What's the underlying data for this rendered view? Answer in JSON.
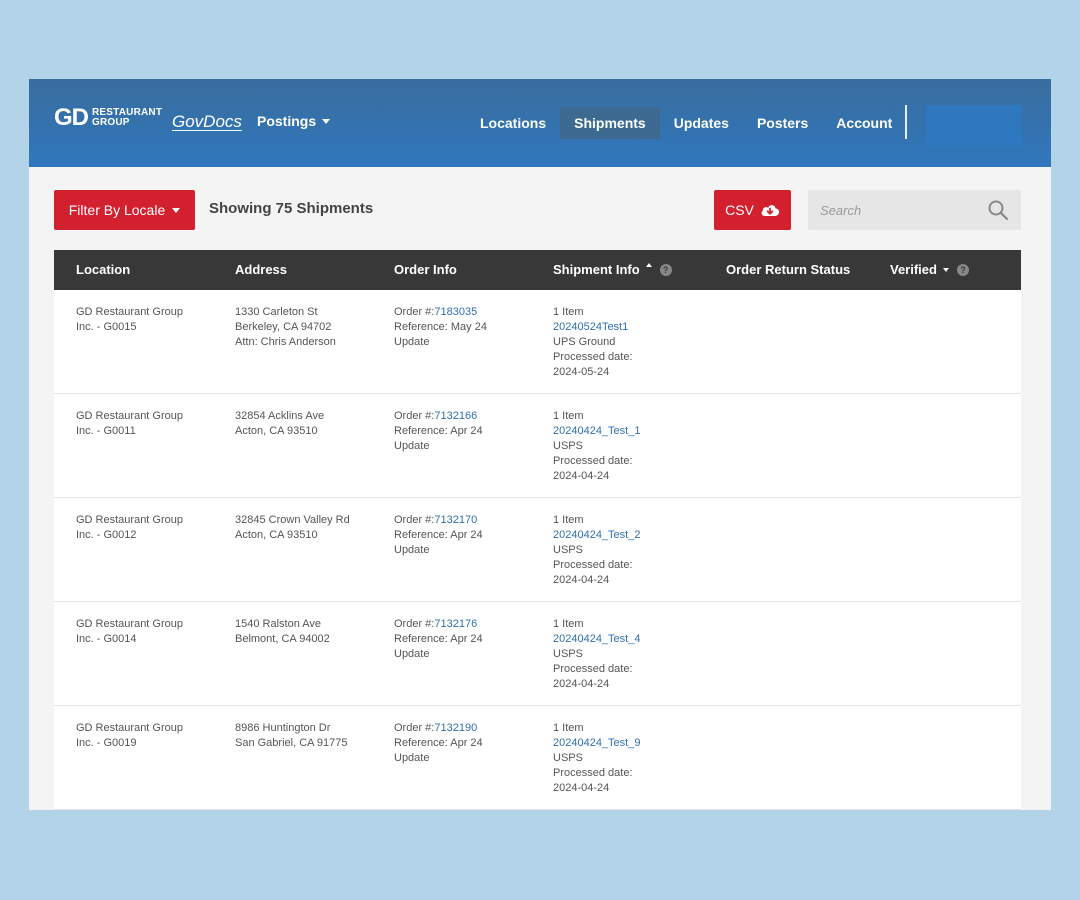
{
  "colors": {
    "page_bg": "#b3d3e8",
    "header_bg": "#2f77bd",
    "accent_red": "#d3202f",
    "table_header_bg": "#383838",
    "link": "#2f6fae"
  },
  "header": {
    "logo": {
      "mark": "GD",
      "line1": "RESTAURANT",
      "line2": "GROUP"
    },
    "brand": "GovDocs",
    "postings_label": "Postings",
    "nav": [
      {
        "label": "Locations",
        "active": false
      },
      {
        "label": "Shipments",
        "active": true
      },
      {
        "label": "Updates",
        "active": false
      },
      {
        "label": "Posters",
        "active": false
      },
      {
        "label": "Account",
        "active": false
      }
    ]
  },
  "toolbar": {
    "filter_label": "Filter By Locale",
    "showing_text": "Showing 75 Shipments",
    "csv_label": "CSV",
    "search_placeholder": "Search",
    "icons": {
      "csv": "cloud-download-icon",
      "search": "search-icon"
    }
  },
  "table": {
    "columns": [
      {
        "label": "Location"
      },
      {
        "label": "Address"
      },
      {
        "label": "Order Info"
      },
      {
        "label": "Shipment Info",
        "sort": "up",
        "help": true
      },
      {
        "label": "Order Return Status"
      },
      {
        "label": "Verified",
        "sort": "down",
        "help": true
      }
    ],
    "rows": [
      {
        "location": [
          "GD Restaurant Group",
          "Inc. - G0015"
        ],
        "address": [
          "1330 Carleton St",
          "Berkeley, CA 94702",
          "Attn: Chris Anderson"
        ],
        "order_prefix": "Order #:",
        "order_number": "7183035",
        "order_reference": [
          "Reference: May 24",
          "Update"
        ],
        "items": "1 Item",
        "shipment_id": "20240524Test1",
        "carrier": "UPS Ground",
        "processed_label": "Processed date:",
        "processed_date": "2024-05-24"
      },
      {
        "location": [
          "GD Restaurant Group",
          "Inc. - G0011"
        ],
        "address": [
          "32854 Acklins Ave",
          "Acton, CA 93510"
        ],
        "order_prefix": "Order #:",
        "order_number": "7132166",
        "order_reference": [
          "Reference: Apr 24",
          "Update"
        ],
        "items": "1 Item",
        "shipment_id": "20240424_Test_1",
        "carrier": "USPS",
        "processed_label": "Processed date:",
        "processed_date": "2024-04-24"
      },
      {
        "location": [
          "GD Restaurant Group",
          "Inc. - G0012"
        ],
        "address": [
          "32845 Crown Valley Rd",
          "Acton, CA 93510"
        ],
        "order_prefix": "Order #:",
        "order_number": "7132170",
        "order_reference": [
          "Reference: Apr 24",
          "Update"
        ],
        "items": "1 Item",
        "shipment_id": "20240424_Test_2",
        "carrier": "USPS",
        "processed_label": "Processed date:",
        "processed_date": "2024-04-24"
      },
      {
        "location": [
          "GD Restaurant Group",
          "Inc. - G0014"
        ],
        "address": [
          "1540 Ralston Ave",
          "Belmont, CA 94002"
        ],
        "order_prefix": "Order #:",
        "order_number": "7132176",
        "order_reference": [
          "Reference: Apr 24",
          "Update"
        ],
        "items": "1 Item",
        "shipment_id": "20240424_Test_4",
        "carrier": "USPS",
        "processed_label": "Processed date:",
        "processed_date": "2024-04-24"
      },
      {
        "location": [
          "GD Restaurant Group",
          "Inc. - G0019"
        ],
        "address": [
          "8986 Huntington Dr",
          "San Gabriel, CA 91775"
        ],
        "order_prefix": "Order #:",
        "order_number": "7132190",
        "order_reference": [
          "Reference: Apr 24",
          "Update"
        ],
        "items": "1 Item",
        "shipment_id": "20240424_Test_9",
        "carrier": "USPS",
        "processed_label": "Processed date:",
        "processed_date": "2024-04-24"
      }
    ]
  }
}
